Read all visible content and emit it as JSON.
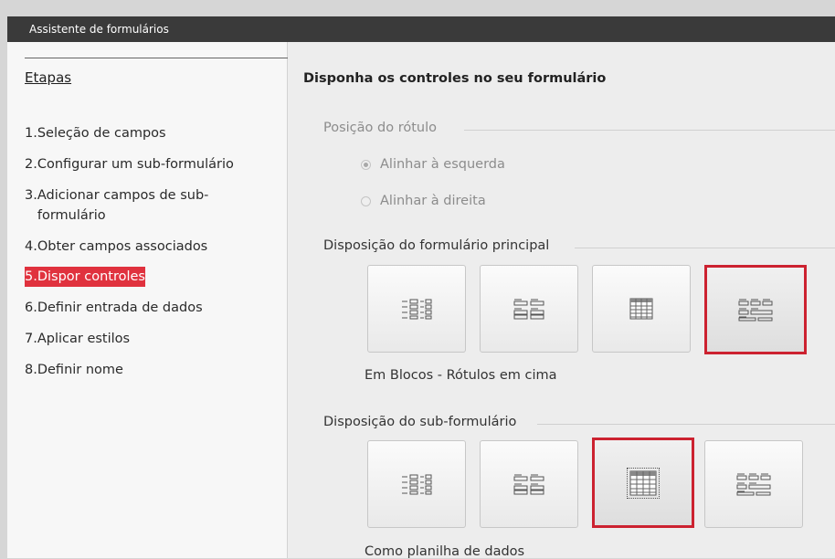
{
  "window": {
    "title": "Assistente de formulários"
  },
  "sidebar": {
    "header": "Etapas",
    "steps": [
      {
        "num": "1.",
        "label": "Seleção de campos"
      },
      {
        "num": "2.",
        "label": "Configurar um sub-formulário"
      },
      {
        "num": "3.",
        "label": "Adicionar campos de sub-formulário"
      },
      {
        "num": "4.",
        "label": "Obter campos associados"
      },
      {
        "num": "5.",
        "label": "Dispor controles",
        "active": true
      },
      {
        "num": "6.",
        "label": "Definir entrada de dados"
      },
      {
        "num": "7.",
        "label": "Aplicar estilos"
      },
      {
        "num": "8.",
        "label": "Definir nome"
      }
    ]
  },
  "main": {
    "title": "Disponha os controles no seu formulário",
    "label_position": {
      "title": "Posição do rótulo",
      "options": [
        {
          "label": "Alinhar à esquerda",
          "checked": true
        },
        {
          "label": "Alinhar à direita",
          "checked": false
        }
      ]
    },
    "main_form": {
      "title": "Disposição do formulário principal",
      "selected_index": 3,
      "selected_caption": "Em Blocos - Rótulos em cima",
      "layouts": [
        "columnar-labels-left-icon",
        "columnar-labels-top-icon",
        "datasheet-icon",
        "blocks-labels-top-icon"
      ]
    },
    "sub_form": {
      "title": "Disposição do sub-formulário",
      "selected_index": 2,
      "selected_caption": "Como planilha de dados",
      "layouts": [
        "columnar-labels-left-icon",
        "columnar-labels-top-icon",
        "datasheet-icon",
        "blocks-labels-top-icon"
      ]
    }
  },
  "colors": {
    "accent": "#e0323e",
    "titlebar": "#3a3a3a",
    "selection_border": "#cc2230"
  }
}
